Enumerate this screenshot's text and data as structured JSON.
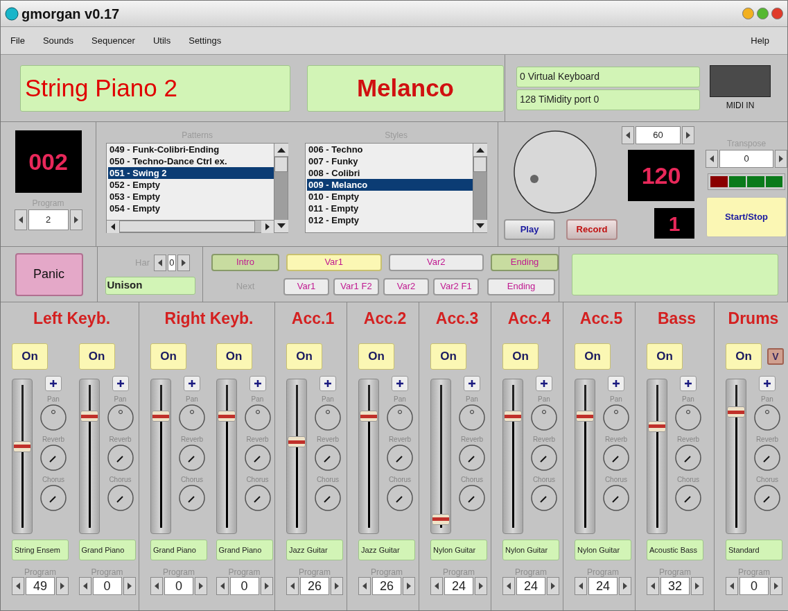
{
  "window": {
    "title": "gmorgan v0.17"
  },
  "menu": {
    "left": [
      {
        "label": "File"
      },
      {
        "label": "Sounds"
      },
      {
        "label": "Sequencer"
      },
      {
        "label": "Utils"
      },
      {
        "label": "Settings"
      }
    ],
    "right": [
      {
        "label": "Help"
      }
    ]
  },
  "displays": {
    "sound": "String Piano 2",
    "style": "Melanco"
  },
  "midi": {
    "ports": [
      "0 Virtual Keyboard",
      "128 TiMidity port 0"
    ],
    "indicator_label": "MIDI IN"
  },
  "program": {
    "display": "002",
    "label": "Program",
    "value": "2"
  },
  "patterns": {
    "label": "Patterns",
    "items": [
      {
        "text": "049 - Funk-Colibri-Ending",
        "selected": false
      },
      {
        "text": "050 - Techno-Dance Ctrl ex.",
        "selected": false
      },
      {
        "text": "051 - Swing 2",
        "selected": true
      },
      {
        "text": "052 - Empty",
        "selected": false
      },
      {
        "text": "053 - Empty",
        "selected": false
      },
      {
        "text": "054 - Empty",
        "selected": false
      }
    ]
  },
  "styles": {
    "label": "Styles",
    "items": [
      {
        "text": "006 - Techno",
        "selected": false
      },
      {
        "text": "007 - Funky",
        "selected": false
      },
      {
        "text": "008 - Colibri",
        "selected": false
      },
      {
        "text": "009 - Melanco",
        "selected": true
      },
      {
        "text": "010 - Empty",
        "selected": false
      },
      {
        "text": "011 - Empty",
        "selected": false
      },
      {
        "text": "012 - Empty",
        "selected": false
      }
    ]
  },
  "tempo": {
    "value": "60",
    "display": "120",
    "measure": "1"
  },
  "transport": {
    "play": "Play",
    "record": "Record",
    "start_stop": "Start/Stop"
  },
  "transpose": {
    "label": "Transpose",
    "value": "0"
  },
  "beat_lights": [
    {
      "active": true
    },
    {
      "active": false
    },
    {
      "active": false
    },
    {
      "active": false
    }
  ],
  "panic": "Panic",
  "harmony": {
    "label": "Har",
    "value": "0",
    "mode": "Unison"
  },
  "variations": [
    {
      "label": "Intro",
      "kind": "intro",
      "selected": false
    },
    {
      "label": "Var1",
      "kind": "var",
      "selected": true
    },
    {
      "label": "Var2",
      "kind": "var",
      "selected": false
    },
    {
      "label": "Ending",
      "kind": "ending",
      "selected": false
    }
  ],
  "next": {
    "label": "Next",
    "buttons": [
      "Var1",
      "Var1 F2",
      "Var2",
      "Var2 F1",
      "Ending"
    ]
  },
  "channels": [
    {
      "title": "Left Keyb.",
      "strips": [
        {
          "on": "On",
          "level": 0.57,
          "knob_labels": [
            "Pan",
            "Reverb",
            "Chorus"
          ],
          "instrument": "String Ensem",
          "program_label": "Program",
          "program": "49"
        },
        {
          "on": "On",
          "level": 0.78,
          "knob_labels": [
            "Pan",
            "Reverb",
            "Chorus"
          ],
          "instrument": "Grand Piano",
          "program_label": "Program",
          "program": "0"
        }
      ]
    },
    {
      "title": "Right Keyb.",
      "strips": [
        {
          "on": "On",
          "level": 0.78,
          "knob_labels": [
            "Pan",
            "Reverb",
            "Chorus"
          ],
          "instrument": "Grand Piano",
          "program_label": "Program",
          "program": "0"
        },
        {
          "on": "On",
          "level": 0.78,
          "knob_labels": [
            "Pan",
            "Reverb",
            "Chorus"
          ],
          "instrument": "Grand Piano",
          "program_label": "Program",
          "program": "0"
        }
      ]
    },
    {
      "title": "Acc.1",
      "strips": [
        {
          "on": "On",
          "level": 0.6,
          "knob_labels": [
            "Pan",
            "Reverb",
            "Chorus"
          ],
          "instrument": "Jazz Guitar",
          "program_label": "Program",
          "program": "26"
        }
      ]
    },
    {
      "title": "Acc.2",
      "strips": [
        {
          "on": "On",
          "level": 0.78,
          "knob_labels": [
            "Pan",
            "Reverb",
            "Chorus"
          ],
          "instrument": "Jazz Guitar",
          "program_label": "Program",
          "program": "26"
        }
      ]
    },
    {
      "title": "Acc.3",
      "strips": [
        {
          "on": "On",
          "level": 0.06,
          "knob_labels": [
            "Pan",
            "Reverb",
            "Chorus"
          ],
          "instrument": "Nylon Guitar",
          "program_label": "Program",
          "program": "24"
        }
      ]
    },
    {
      "title": "Acc.4",
      "strips": [
        {
          "on": "On",
          "level": 0.78,
          "knob_labels": [
            "Pan",
            "Reverb",
            "Chorus"
          ],
          "instrument": "Nylon Guitar",
          "program_label": "Program",
          "program": "24"
        }
      ]
    },
    {
      "title": "Acc.5",
      "strips": [
        {
          "on": "On",
          "level": 0.78,
          "knob_labels": [
            "Pan",
            "Reverb",
            "Chorus"
          ],
          "instrument": "Nylon Guitar",
          "program_label": "Program",
          "program": "24"
        }
      ]
    },
    {
      "title": "Bass",
      "strips": [
        {
          "on": "On",
          "level": 0.71,
          "knob_labels": [
            "Pan",
            "Reverb",
            "Chorus"
          ],
          "instrument": "Acoustic Bass",
          "program_label": "Program",
          "program": "32"
        }
      ]
    },
    {
      "title": "Drums",
      "strips": [
        {
          "on": "On",
          "extra": "V",
          "level": 0.81,
          "knob_labels": [
            "Pan",
            "Reverb",
            "Chorus"
          ],
          "instrument": "Standard",
          "program_label": "Program",
          "program": "0"
        }
      ]
    }
  ]
}
